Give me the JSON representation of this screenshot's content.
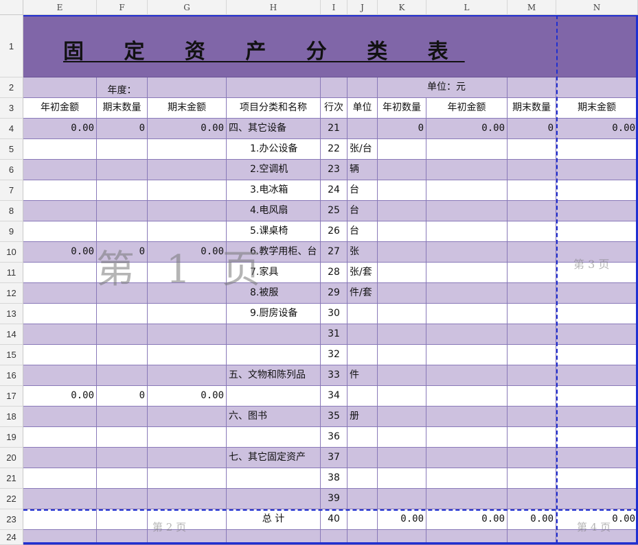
{
  "columns": [
    "E",
    "F",
    "G",
    "H",
    "I",
    "J",
    "K",
    "L",
    "M",
    "N"
  ],
  "title": "固 定 资 产 分 类 表",
  "row2": {
    "year_label": "年度：",
    "unit_label": "单位：元"
  },
  "headers": [
    "年初金额",
    "期末数量",
    "期末金额",
    "项目分类和名称",
    "行次",
    "单位",
    "年初数量",
    "年初金额",
    "期末数量",
    "期末金额"
  ],
  "row_numbers": [
    "1",
    "2",
    "3",
    "4",
    "5",
    "6",
    "7",
    "8",
    "9",
    "10",
    "11",
    "12",
    "13",
    "14",
    "15",
    "16",
    "17",
    "18",
    "19",
    "20",
    "21",
    "22",
    "23",
    "24"
  ],
  "data_rows": [
    {
      "E": "0.00",
      "F": "0",
      "G": "0.00",
      "H": "四、其它设备",
      "I": "21",
      "J": "",
      "K": "0",
      "L": "0.00",
      "M": "0",
      "N": "0.00"
    },
    {
      "E": "",
      "F": "",
      "G": "",
      "H": "1.办公设备",
      "I": "22",
      "J": "张/台",
      "K": "",
      "L": "",
      "M": "",
      "N": ""
    },
    {
      "E": "",
      "F": "",
      "G": "",
      "H": "2.空调机",
      "I": "23",
      "J": "辆",
      "K": "",
      "L": "",
      "M": "",
      "N": ""
    },
    {
      "E": "",
      "F": "",
      "G": "",
      "H": "3.电冰箱",
      "I": "24",
      "J": "台",
      "K": "",
      "L": "",
      "M": "",
      "N": ""
    },
    {
      "E": "",
      "F": "",
      "G": "",
      "H": "4.电风扇",
      "I": "25",
      "J": "台",
      "K": "",
      "L": "",
      "M": "",
      "N": ""
    },
    {
      "E": "",
      "F": "",
      "G": "",
      "H": "5.课桌椅",
      "I": "26",
      "J": "台",
      "K": "",
      "L": "",
      "M": "",
      "N": ""
    },
    {
      "E": "0.00",
      "F": "0",
      "G": "0.00",
      "H": "6.教学用柜、台",
      "I": "27",
      "J": "张",
      "K": "",
      "L": "",
      "M": "",
      "N": ""
    },
    {
      "E": "",
      "F": "",
      "G": "",
      "H": "7.家具",
      "I": "28",
      "J": "张/套",
      "K": "",
      "L": "",
      "M": "",
      "N": ""
    },
    {
      "E": "",
      "F": "",
      "G": "",
      "H": "8.被服",
      "I": "29",
      "J": "件/套",
      "K": "",
      "L": "",
      "M": "",
      "N": ""
    },
    {
      "E": "",
      "F": "",
      "G": "",
      "H": "9.厨房设备",
      "I": "30",
      "J": "",
      "K": "",
      "L": "",
      "M": "",
      "N": ""
    },
    {
      "E": "",
      "F": "",
      "G": "",
      "H": "",
      "I": "31",
      "J": "",
      "K": "",
      "L": "",
      "M": "",
      "N": ""
    },
    {
      "E": "",
      "F": "",
      "G": "",
      "H": "",
      "I": "32",
      "J": "",
      "K": "",
      "L": "",
      "M": "",
      "N": ""
    },
    {
      "E": "",
      "F": "",
      "G": "",
      "H": "五、文物和陈列品",
      "I": "33",
      "J": "件",
      "K": "",
      "L": "",
      "M": "",
      "N": ""
    },
    {
      "E": "0.00",
      "F": "0",
      "G": "0.00",
      "H": "",
      "I": "34",
      "J": "",
      "K": "",
      "L": "",
      "M": "",
      "N": ""
    },
    {
      "E": "",
      "F": "",
      "G": "",
      "H": "六、图书",
      "I": "35",
      "J": "册",
      "K": "",
      "L": "",
      "M": "",
      "N": ""
    },
    {
      "E": "",
      "F": "",
      "G": "",
      "H": "",
      "I": "36",
      "J": "",
      "K": "",
      "L": "",
      "M": "",
      "N": ""
    },
    {
      "E": "",
      "F": "",
      "G": "",
      "H": "七、其它固定资产",
      "I": "37",
      "J": "",
      "K": "",
      "L": "",
      "M": "",
      "N": ""
    },
    {
      "E": "",
      "F": "",
      "G": "",
      "H": "",
      "I": "38",
      "J": "",
      "K": "",
      "L": "",
      "M": "",
      "N": ""
    },
    {
      "E": "",
      "F": "",
      "G": "",
      "H": "",
      "I": "39",
      "J": "",
      "K": "",
      "L": "",
      "M": "",
      "N": ""
    },
    {
      "E": "",
      "F": "",
      "G": "",
      "H": "总    计",
      "I": "40",
      "J": "",
      "K": "0.00",
      "L": "0.00",
      "M": "0.00",
      "N": "0.00"
    },
    {
      "E": "",
      "F": "",
      "G": "",
      "H": "",
      "I": "",
      "J": "",
      "K": "",
      "L": "",
      "M": "",
      "N": ""
    }
  ],
  "watermarks": {
    "page1": "第 1 页",
    "page2": "第 2 页",
    "page3": "第 3 页",
    "page4": "第 4 页"
  },
  "colors": {
    "title_bg": "#8066a8",
    "band": "#cdc1df",
    "page_break": "#1f2fd0"
  }
}
